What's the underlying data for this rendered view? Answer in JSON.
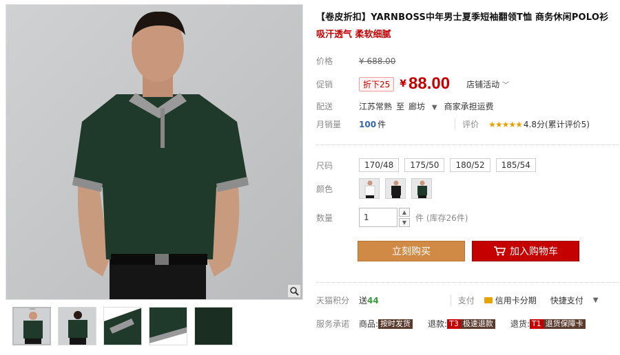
{
  "product": {
    "title": "【卷皮折扣】YARNBOSS中年男士夏季短袖翻领T恤 商务休闲POLO衫",
    "subtitle": "吸汗透气 柔软细腻"
  },
  "price": {
    "label": "价格",
    "original": "¥ 688.00"
  },
  "promo": {
    "label": "促销",
    "badge": "折下25",
    "currency": "¥",
    "price": "88.00",
    "shop_activity": "店铺活动"
  },
  "delivery": {
    "label": "配送",
    "from": "江苏常熟",
    "to_word": "至",
    "to": "廊坊",
    "carrier": "商家承担运费"
  },
  "sales": {
    "label": "月销量",
    "count": "100",
    "unit": "件",
    "review_label": "评价",
    "stars": "★★★★★",
    "score": "4.8分(累计评价5)"
  },
  "size": {
    "label": "尺码",
    "options": [
      "170/48",
      "175/50",
      "180/52",
      "185/54"
    ]
  },
  "color": {
    "label": "颜色",
    "options": [
      "white-shirt",
      "black-shirt",
      "green-shirt"
    ]
  },
  "quantity": {
    "label": "数量",
    "value": "1",
    "unit_stock": "件 (库存26件)"
  },
  "buttons": {
    "buy": "立刻购买",
    "cart": "加入购物车"
  },
  "points": {
    "label": "天猫积分",
    "give": "送",
    "amount": "44",
    "pay_label": "支付",
    "card": "信用卡分期",
    "quick": "快捷支付"
  },
  "service": {
    "label": "服务承诺",
    "item1_label": "商品:",
    "item1_tag": "按时发货",
    "item2_label": "退款:",
    "item2_t": "T3",
    "item2_tag": "极速退款",
    "item3_label": "退货:",
    "item3_t": "T1",
    "item3_tag": "退货保障卡"
  },
  "colors": {
    "accent_red": "#c40000",
    "buy_orange": "#d18a46",
    "shirt_green": "#1f3a2a"
  }
}
